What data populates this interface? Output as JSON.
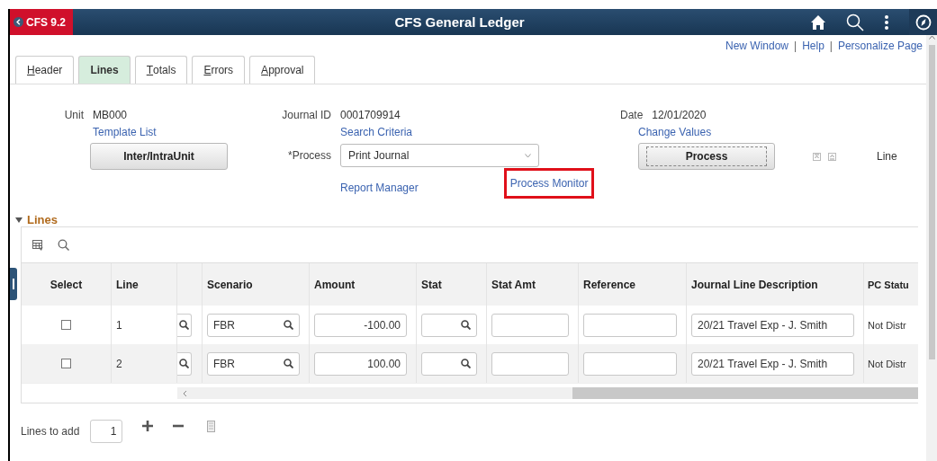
{
  "banner": {
    "back_label": "CFS 9.2",
    "title": "CFS General Ledger"
  },
  "links": [
    "New Window",
    "Help",
    "Personalize Page"
  ],
  "link_separator": "|",
  "tabs": [
    {
      "label": "Header",
      "selected": false,
      "access_key": true
    },
    {
      "label": "Lines",
      "selected": true,
      "access_key": false
    },
    {
      "label": "Totals",
      "selected": false,
      "access_key": true
    },
    {
      "label": "Errors",
      "selected": false,
      "access_key": true
    },
    {
      "label": "Approval",
      "selected": false,
      "access_key": true
    }
  ],
  "header": {
    "unit": {
      "label": "Unit",
      "value": "MB000"
    },
    "template_link": "Template List",
    "interunit_button": "Inter/IntraUnit",
    "journal_id": {
      "label": "Journal ID",
      "value": "0001709914"
    },
    "search_link": "Search Criteria",
    "process": {
      "label": "*Process",
      "value": "Print Journal"
    },
    "report_manager_link": "Report Manager",
    "process_monitor": {
      "label": "Process Monitor",
      "highlighted": true
    },
    "date": {
      "label": "Date",
      "value": "12/01/2020"
    },
    "change_values_link": "Change Values",
    "process_button": "Process",
    "line_label": "Line"
  },
  "lines_section": {
    "title": "Lines",
    "expanded": true,
    "columns": [
      "Select",
      "Line",
      "Scenario",
      "Amount",
      "Stat",
      "Stat Amt",
      "Reference",
      "Journal Line Description",
      "PC Statu"
    ],
    "rows": [
      {
        "checked": false,
        "line": "1",
        "scenario": "FBR",
        "amount": "-100.00",
        "description": "20/21 Travel Exp - J. Smith",
        "pc_status": "Not Distr"
      },
      {
        "checked": false,
        "line": "2",
        "scenario": "FBR",
        "amount": "100.00",
        "description": "20/21 Travel Exp - J. Smith",
        "pc_status": "Not Distr"
      }
    ]
  },
  "lines_to_add": {
    "label": "Lines to add",
    "value": "1"
  }
}
